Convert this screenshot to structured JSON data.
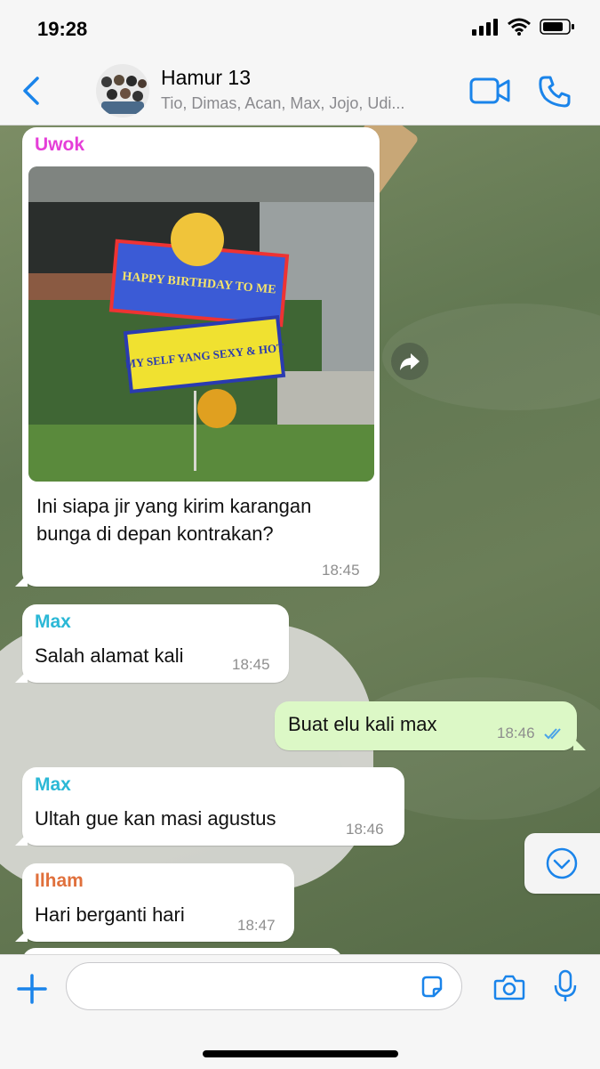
{
  "status_bar": {
    "time": "19:28"
  },
  "header": {
    "group_name": "Hamur 13",
    "members": "Tio, Dimas, Acan, Max, Jojo, Udi...",
    "accent": "#1a84ea"
  },
  "messages": [
    {
      "sender": "Uwok",
      "sender_color": "#e53ed8",
      "photo_banner_top": "HAPPY BIRTHDAY TO ME",
      "photo_banner_bottom": "MY SELF YANG SEXY & HOT",
      "text_line1": "Ini siapa jir yang kirim karangan",
      "text_line2": "bunga di depan kontrakan?",
      "time": "18:45"
    },
    {
      "sender": "Max",
      "sender_color": "#2bb8d6",
      "text": "Salah alamat kali",
      "time": "18:45"
    },
    {
      "direction": "outgoing",
      "text": "Buat elu kali max",
      "time": "18:46",
      "status_icon": "double-check-icon"
    },
    {
      "sender": "Max",
      "sender_color": "#2bb8d6",
      "text": "Ultah gue kan masi agustus",
      "time": "18:46"
    },
    {
      "sender": "Ilham",
      "sender_color": "#e0703c",
      "text": "Hari berganti hari",
      "time": "18:47"
    }
  ],
  "input": {
    "placeholder": ""
  }
}
